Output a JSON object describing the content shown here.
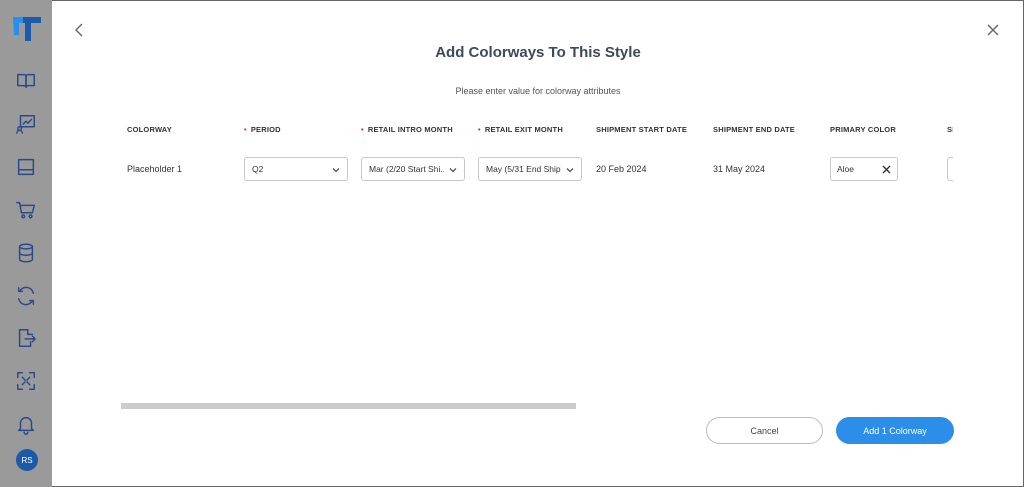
{
  "sidebar": {
    "logo_icon": "tt-logo-icon",
    "items": [
      {
        "icon": "book-icon"
      },
      {
        "icon": "presentation-icon"
      },
      {
        "icon": "inbox-icon"
      },
      {
        "icon": "cart-icon"
      },
      {
        "icon": "database-icon"
      },
      {
        "icon": "refresh-icon"
      },
      {
        "icon": "export-icon"
      },
      {
        "icon": "scan-icon"
      },
      {
        "icon": "bell-icon"
      }
    ],
    "avatar_initials": "RS"
  },
  "modal": {
    "title": "Add Colorways To This Style",
    "subtitle": "Please enter value for colorway attributes",
    "columns": [
      {
        "label": "COLORWAY",
        "required": false
      },
      {
        "label": "PERIOD",
        "required": true
      },
      {
        "label": "RETAIL INTRO MONTH",
        "required": true
      },
      {
        "label": "RETAIL EXIT MONTH",
        "required": true
      },
      {
        "label": "SHIPMENT START DATE",
        "required": false
      },
      {
        "label": "SHIPMENT END DATE",
        "required": false
      },
      {
        "label": "PRIMARY COLOR",
        "required": false
      },
      {
        "label": "SI",
        "required": false
      }
    ],
    "row": {
      "colorway": "Placeholder 1",
      "period": "Q2",
      "retail_intro_month": "Mar (2/20 Start Shi...",
      "retail_exit_month": "May (5/31 End Ship)",
      "shipment_start_date": "20 Feb 2024",
      "shipment_end_date": "31 May 2024",
      "primary_color": "Aloe"
    },
    "cancel_label": "Cancel",
    "add_label": "Add 1 Colorway"
  },
  "colors": {
    "accent": "#2b8fea",
    "sidebar_bg": "#9a9a9a",
    "icon": "#2a4a8a"
  }
}
